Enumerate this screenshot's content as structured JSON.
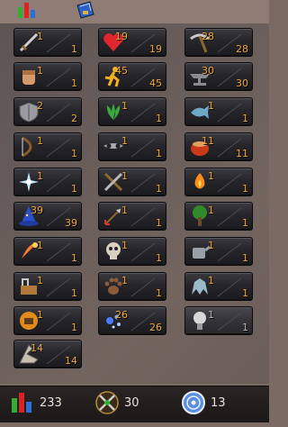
{
  "skills": [
    {
      "name": "Attack",
      "current": "1",
      "base": "1"
    },
    {
      "name": "Constitution",
      "current": "19",
      "base": "19"
    },
    {
      "name": "Mining",
      "current": "28",
      "base": "28"
    },
    {
      "name": "Strength",
      "current": "1",
      "base": "1"
    },
    {
      "name": "Agility",
      "current": "45",
      "base": "45"
    },
    {
      "name": "Smithing",
      "current": "30",
      "base": "30"
    },
    {
      "name": "Defence",
      "current": "2",
      "base": "2"
    },
    {
      "name": "Herblore",
      "current": "1",
      "base": "1"
    },
    {
      "name": "Fishing",
      "current": "1",
      "base": "1"
    },
    {
      "name": "Ranged",
      "current": "1",
      "base": "1"
    },
    {
      "name": "Thieving",
      "current": "1",
      "base": "1"
    },
    {
      "name": "Cooking",
      "current": "11",
      "base": "11"
    },
    {
      "name": "Prayer",
      "current": "1",
      "base": "1"
    },
    {
      "name": "Crafting",
      "current": "1",
      "base": "1"
    },
    {
      "name": "Firemaking",
      "current": "1",
      "base": "1"
    },
    {
      "name": "Magic",
      "current": "39",
      "base": "39"
    },
    {
      "name": "Fletching",
      "current": "1",
      "base": "1"
    },
    {
      "name": "Woodcutting",
      "current": "1",
      "base": "1"
    },
    {
      "name": "Runecrafting",
      "current": "1",
      "base": "1"
    },
    {
      "name": "Slayer",
      "current": "1",
      "base": "1"
    },
    {
      "name": "Farming",
      "current": "1",
      "base": "1"
    },
    {
      "name": "Construction",
      "current": "1",
      "base": "1"
    },
    {
      "name": "Hunter",
      "current": "1",
      "base": "1"
    },
    {
      "name": "Summoning",
      "current": "1",
      "base": "1"
    },
    {
      "name": "Dungeoneering",
      "current": "1",
      "base": "1"
    },
    {
      "name": "Divination",
      "current": "26",
      "base": "26"
    },
    {
      "name": "Invention",
      "current": "1",
      "base": "1"
    },
    {
      "name": "Archaeology",
      "current": "14",
      "base": "14"
    }
  ],
  "summary": {
    "total_level": "233",
    "combat_level": "30",
    "quest_points": "13"
  },
  "colors": {
    "level_text": "#f2a73a",
    "tile_dark": "#1b1b1f",
    "panel_bg": "#6a5e5b"
  },
  "icons": [
    "attack-icon",
    "constitution-icon",
    "mining-icon",
    "strength-icon",
    "agility-icon",
    "smithing-icon",
    "defence-icon",
    "herblore-icon",
    "fishing-icon",
    "ranged-icon",
    "thieving-icon",
    "cooking-icon",
    "prayer-icon",
    "crafting-icon",
    "firemaking-icon",
    "magic-icon",
    "fletching-icon",
    "woodcutting-icon",
    "runecrafting-icon",
    "slayer-icon",
    "farming-icon",
    "construction-icon",
    "hunter-icon",
    "summoning-icon",
    "dungeoneering-icon",
    "divination-icon",
    "invention-icon",
    "archaeology-icon",
    "stats-tab-icon",
    "quest-journal-icon",
    "total-level-icon",
    "combat-level-icon",
    "quest-points-icon"
  ]
}
